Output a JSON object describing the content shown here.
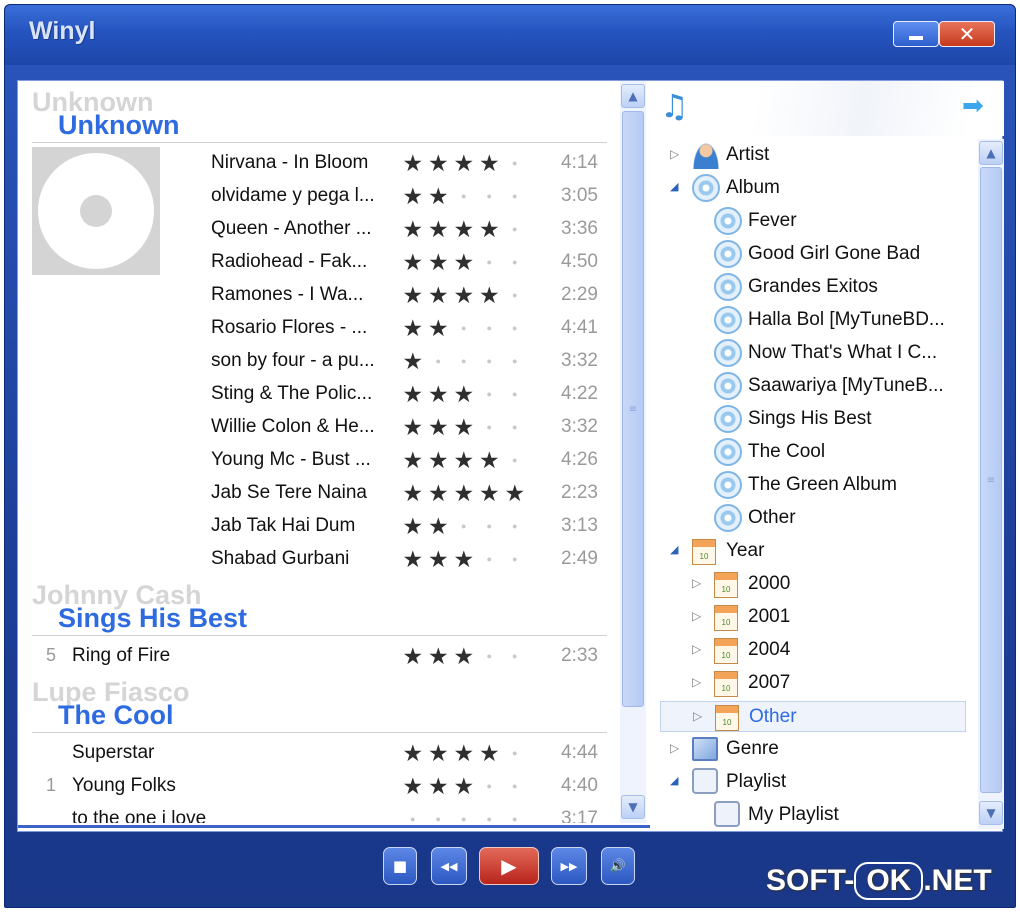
{
  "window": {
    "title": "Winyl"
  },
  "titlebar": {
    "close_glyph": "✕"
  },
  "groups": [
    {
      "artist": "Unknown",
      "album": "Unknown",
      "tracks": [
        {
          "num": "",
          "name": "Nirvana - In Bloom",
          "rating": 4,
          "duration": "4:14"
        },
        {
          "num": "",
          "name": "olvidame y pega l...",
          "rating": 2,
          "duration": "3:05"
        },
        {
          "num": "",
          "name": "Queen - Another ...",
          "rating": 4,
          "duration": "3:36"
        },
        {
          "num": "",
          "name": "Radiohead - Fak...",
          "rating": 3,
          "duration": "4:50"
        },
        {
          "num": "",
          "name": "Ramones - I Wa...",
          "rating": 4,
          "duration": "2:29"
        },
        {
          "num": "",
          "name": "Rosario Flores - ...",
          "rating": 2,
          "duration": "4:41"
        },
        {
          "num": "",
          "name": "son by four - a pu...",
          "rating": 1,
          "duration": "3:32"
        },
        {
          "num": "",
          "name": "Sting & The Polic...",
          "rating": 3,
          "duration": "4:22"
        },
        {
          "num": "",
          "name": "Willie Colon & He...",
          "rating": 3,
          "duration": "3:32"
        },
        {
          "num": "",
          "name": "Young Mc - Bust ...",
          "rating": 4,
          "duration": "4:26"
        },
        {
          "num": "",
          "name": "Jab Se Tere Naina",
          "rating": 5,
          "duration": "2:23"
        },
        {
          "num": "",
          "name": "Jab Tak Hai Dum",
          "rating": 2,
          "duration": "3:13"
        },
        {
          "num": "",
          "name": "Shabad Gurbani",
          "rating": 3,
          "duration": "2:49"
        }
      ]
    },
    {
      "artist": "Johnny Cash",
      "album": "Sings His Best",
      "tracks": [
        {
          "num": "5",
          "name": "Ring of Fire",
          "rating": 3,
          "duration": "2:33"
        }
      ]
    },
    {
      "artist": "Lupe Fiasco",
      "album": "The Cool",
      "tracks": [
        {
          "num": "",
          "name": "Superstar",
          "rating": 4,
          "duration": "4:44"
        },
        {
          "num": "1",
          "name": "Young Folks",
          "rating": 3,
          "duration": "4:40"
        },
        {
          "num": "",
          "name": "to the one i love",
          "rating": 0,
          "duration": "3:17"
        }
      ]
    }
  ],
  "tree": [
    {
      "label": "Artist",
      "icon": "artist-icon",
      "level": 0,
      "expander": "closed"
    },
    {
      "label": "Album",
      "icon": "album-icon",
      "level": 0,
      "expander": "open"
    },
    {
      "label": "Fever",
      "icon": "album-icon",
      "level": 1,
      "expander": "none"
    },
    {
      "label": "Good Girl Gone Bad",
      "icon": "album-icon",
      "level": 1,
      "expander": "none"
    },
    {
      "label": "Grandes Exitos",
      "icon": "album-icon",
      "level": 1,
      "expander": "none"
    },
    {
      "label": "Halla Bol [MyTuneBD...",
      "icon": "album-icon",
      "level": 1,
      "expander": "none"
    },
    {
      "label": "Now That's What I C...",
      "icon": "album-icon",
      "level": 1,
      "expander": "none"
    },
    {
      "label": "Saawariya [MyTuneB...",
      "icon": "album-icon",
      "level": 1,
      "expander": "none"
    },
    {
      "label": "Sings His Best",
      "icon": "album-icon",
      "level": 1,
      "expander": "none"
    },
    {
      "label": "The Cool",
      "icon": "album-icon",
      "level": 1,
      "expander": "none"
    },
    {
      "label": "The Green Album",
      "icon": "album-icon",
      "level": 1,
      "expander": "none"
    },
    {
      "label": "Other",
      "icon": "album-icon",
      "level": 1,
      "expander": "none"
    },
    {
      "label": "Year",
      "icon": "calendar-icon",
      "level": 0,
      "expander": "open"
    },
    {
      "label": "2000",
      "icon": "calendar-icon",
      "level": 1,
      "expander": "closed"
    },
    {
      "label": "2001",
      "icon": "calendar-icon",
      "level": 1,
      "expander": "closed"
    },
    {
      "label": "2004",
      "icon": "calendar-icon",
      "level": 1,
      "expander": "closed"
    },
    {
      "label": "2007",
      "icon": "calendar-icon",
      "level": 1,
      "expander": "closed"
    },
    {
      "label": "Other",
      "icon": "calendar-icon",
      "level": 1,
      "expander": "closed",
      "selected": true
    },
    {
      "label": "Genre",
      "icon": "genre-icon",
      "level": 0,
      "expander": "closed"
    },
    {
      "label": "Playlist",
      "icon": "playlist-icon",
      "level": 0,
      "expander": "open"
    },
    {
      "label": "My Playlist",
      "icon": "playlist-icon",
      "level": 1,
      "expander": "none"
    }
  ],
  "calendar_icon_text": "10",
  "controls": {
    "stop": "■",
    "prev": "◀◀",
    "play": "▶",
    "next": "▶▶",
    "volume": "🔊"
  },
  "watermark": {
    "left": "SOFT-",
    "ok": "OK",
    "right": ".NET"
  },
  "colors": {
    "album_title": "#2f6be0",
    "artist_ghost": "#d5d5d5",
    "selected_bg": "#eef3fc"
  }
}
